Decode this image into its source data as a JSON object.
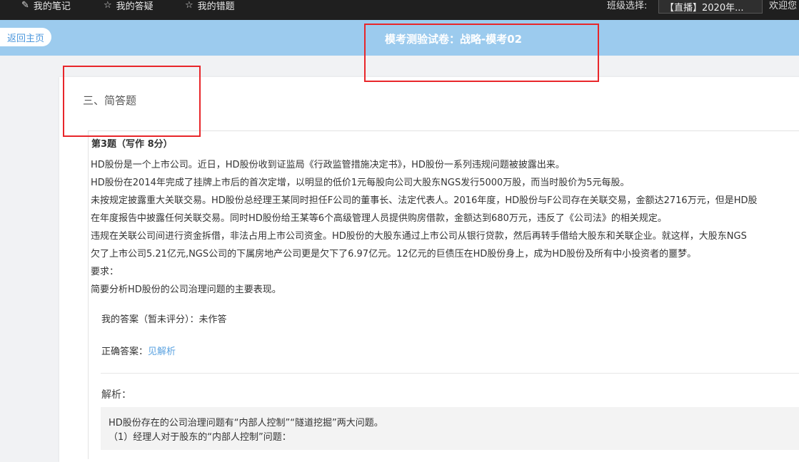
{
  "nav": {
    "items": [
      {
        "label": "我的笔记",
        "icon": "pencil-icon",
        "glyph": "✎"
      },
      {
        "label": "我的答疑",
        "icon": "star-icon",
        "glyph": "☆"
      },
      {
        "label": "我的错题",
        "icon": "star-icon",
        "glyph": "☆"
      }
    ],
    "class_label": "班级选择:",
    "class_value": "【直播】2020年...",
    "welcome": "欢迎您"
  },
  "header": {
    "back_label": "返回主页",
    "exam_title": "模考测验试卷：战略-模考02"
  },
  "section": {
    "title": "三、简答题"
  },
  "question": {
    "number": "第3题（写作  8分）",
    "lines": [
      "HD股份是一个上市公司。近日，HD股份收到证监局《行政监管措施决定书》，HD股份一系列违规问题被披露出来。",
      "HD股份在2014年完成了挂牌上市后的首次定增，以明显的低价1元每股向公司大股东NGS发行5000万股，而当时股价为5元每股。",
      "未按规定披露重大关联交易。HD股份总经理王某同时担任F公司的董事长、法定代表人。2016年度，HD股份与F公司存在关联交易，金额达2716万元，但是HD股",
      "在年度报告中披露任何关联交易。同时HD股份给王某等6个高级管理人员提供购房借款，金额达到680万元，违反了《公司法》的相关规定。",
      "违规在关联公司间进行资金拆借，非法占用上市公司资金。HD股份的大股东通过上市公司从银行贷款，然后再转手借给大股东和关联企业。就这样，大股东NGS",
      "欠了上市公司5.21亿元,NGS公司的下属房地产公司更是欠下了6.97亿元。12亿元的巨债压在HD股份身上，成为HD股份及所有中小投资者的噩梦。",
      "要求：",
      "简要分析HD股份的公司治理问题的主要表现。"
    ]
  },
  "answer": {
    "my_answer": "我的答案（暂未评分）：未作答",
    "correct_label": "正确答案：",
    "correct_link": "见解析"
  },
  "analysis": {
    "title": "解析：",
    "lines": [
      "HD股份存在的公司治理问题有“内部人控制”“隧道挖掘”两大问题。",
      "（1）经理人对于股东的“内部人控制”问题："
    ]
  }
}
